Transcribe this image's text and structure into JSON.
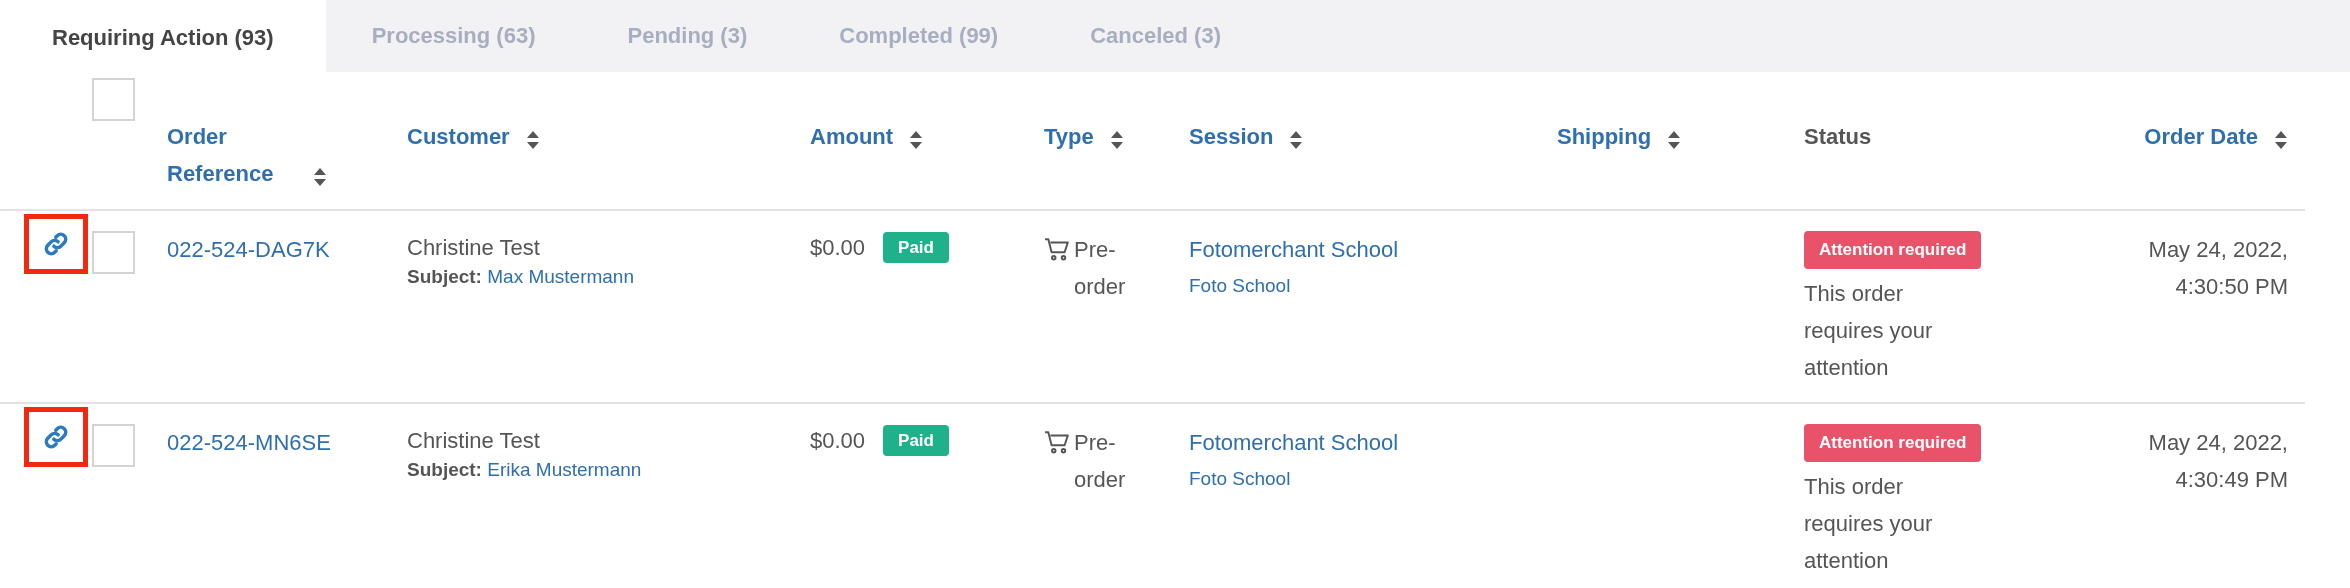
{
  "tabs": [
    {
      "label": "Requiring Action (93)",
      "selected": true
    },
    {
      "label": "Processing (63)",
      "selected": false
    },
    {
      "label": "Pending (3)",
      "selected": false
    },
    {
      "label": "Completed (99)",
      "selected": false
    },
    {
      "label": "Canceled (3)",
      "selected": false
    }
  ],
  "table": {
    "select_all": {
      "checked": false
    },
    "columns": [
      {
        "label": "Order Reference",
        "sortable": true
      },
      {
        "label": "Customer",
        "sortable": true
      },
      {
        "label": "Amount",
        "sortable": true
      },
      {
        "label": "Type",
        "sortable": true
      },
      {
        "label": "Session",
        "sortable": true
      },
      {
        "label": "Shipping",
        "sortable": true
      },
      {
        "label": "Status",
        "sortable": false
      },
      {
        "label": "Order Date",
        "sortable": true
      }
    ],
    "rows": [
      {
        "highlighted": true,
        "checked": false,
        "order_reference": "022-524-DAG7K",
        "customer": "Christine Test",
        "subject_label": "Subject:",
        "subject": "Max Mustermann",
        "amount": "$0.00",
        "payment": "Paid",
        "type": "Pre-order",
        "session": "Fotomerchant School",
        "session_sub": "Foto School",
        "status": "Attention required",
        "status_note": "This order requires your attention",
        "order_date": "May 24, 2022, 4:30:50 PM"
      },
      {
        "highlighted": true,
        "checked": false,
        "order_reference": "022-524-MN6SE",
        "customer": "Christine Test",
        "subject_label": "Subject:",
        "subject": "Erika Mustermann",
        "amount": "$0.00",
        "payment": "Paid",
        "type": "Pre-order",
        "session": "Fotomerchant School",
        "session_sub": "Foto School",
        "status": "Attention required",
        "status_note": "This order requires your attention",
        "order_date": "May 24, 2022, 4:30:49 PM"
      }
    ]
  }
}
